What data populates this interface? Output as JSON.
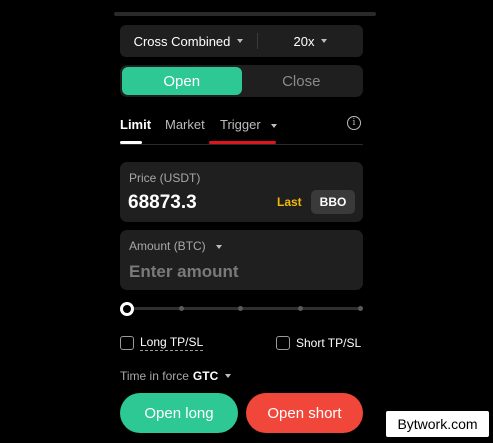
{
  "margin": {
    "mode": "Cross Combined",
    "leverage": "20x"
  },
  "position_toggle": {
    "open": "Open",
    "close": "Close"
  },
  "order_tabs": {
    "limit": "Limit",
    "market": "Market",
    "trigger": "Trigger"
  },
  "price": {
    "label": "Price (USDT)",
    "value": "68873.3",
    "last": "Last",
    "bbo": "BBO"
  },
  "amount": {
    "label": "Amount (BTC)",
    "placeholder": "Enter amount"
  },
  "slider": {
    "value": 0
  },
  "tpsl": {
    "long": "Long TP/SL",
    "short": "Short TP/SL"
  },
  "time_in_force": {
    "label": "Time in force",
    "value": "GTC"
  },
  "actions": {
    "open_long": "Open long",
    "open_short": "Open short"
  },
  "watermark": "Bytwork.com",
  "colors": {
    "accent_green": "#2ec894",
    "accent_red": "#f0473a",
    "highlight_yellow": "#f0b90b",
    "trigger_underline": "#e0141b"
  }
}
